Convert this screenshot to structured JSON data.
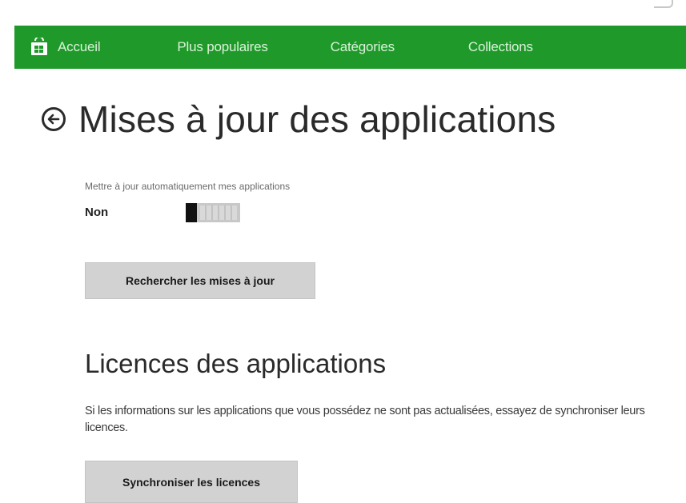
{
  "nav": {
    "items": [
      {
        "label": "Accueil"
      },
      {
        "label": "Plus populaires"
      },
      {
        "label": "Catégories"
      },
      {
        "label": "Collections"
      }
    ],
    "icon": "store-icon",
    "accent_color": "#1f9a2a"
  },
  "page": {
    "title": "Mises à jour des applications",
    "back_icon": "back-arrow-icon"
  },
  "auto_update": {
    "label": "Mettre à jour automatiquement mes applications",
    "state": "Non",
    "enabled": false
  },
  "buttons": {
    "check_updates": "Rechercher les mises à jour",
    "sync_licenses": "Synchroniser les licences"
  },
  "licenses": {
    "title": "Licences des applications",
    "description": "Si les informations sur les applications que vous possédez ne sont pas actualisées, essayez de synchroniser leurs licences."
  }
}
